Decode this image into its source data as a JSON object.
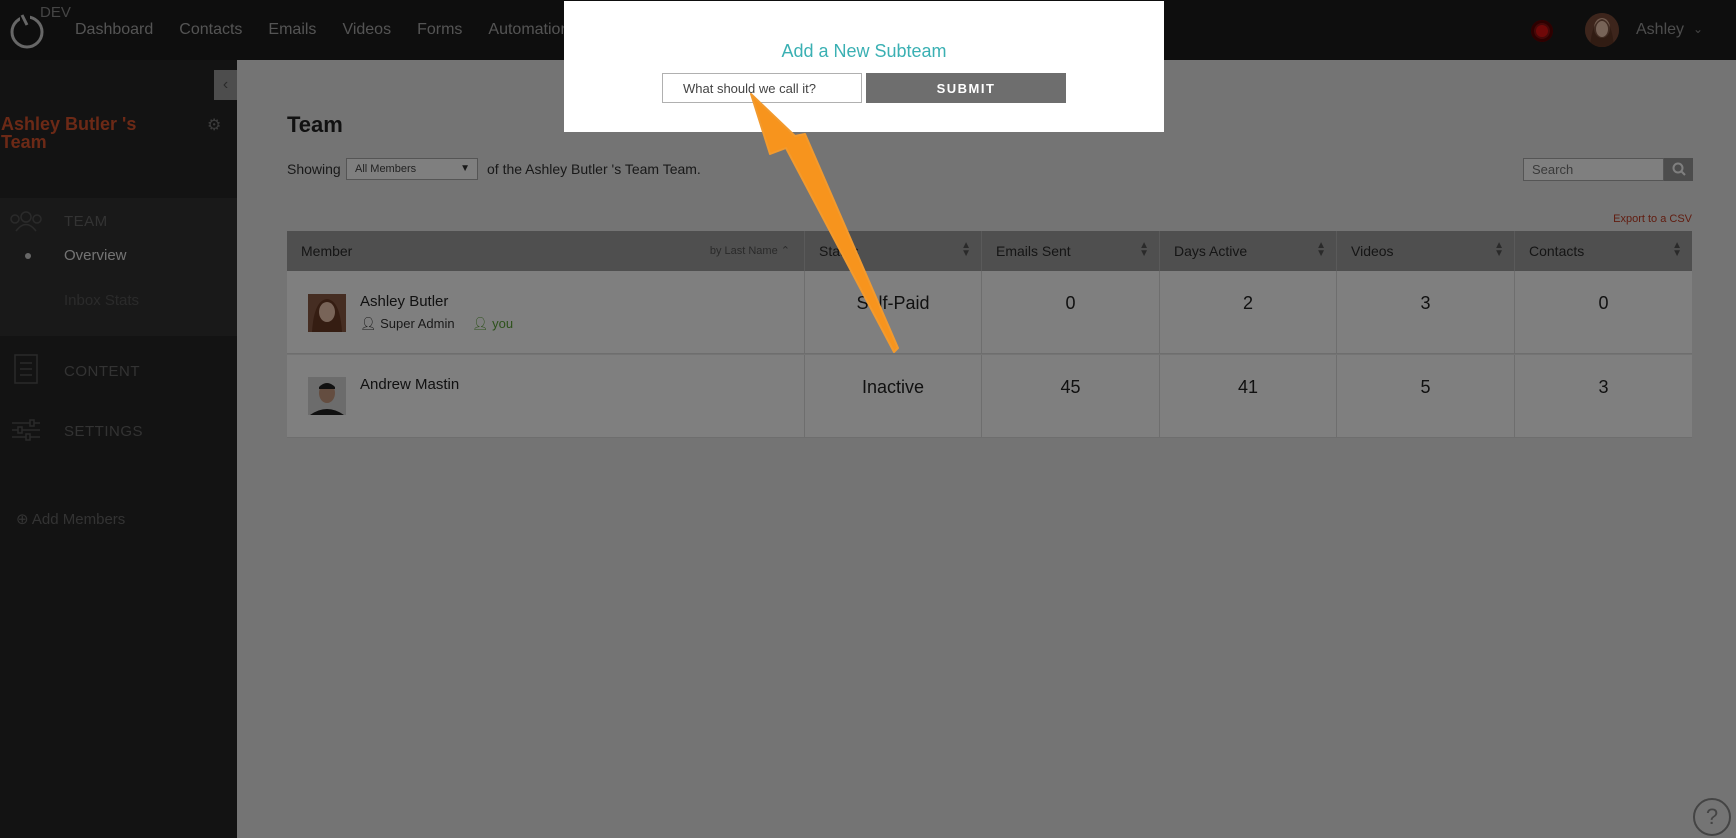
{
  "topbar": {
    "env_label": "DEV",
    "nav": [
      "Dashboard",
      "Contacts",
      "Emails",
      "Videos",
      "Forms",
      "Automations"
    ],
    "username": "Ashley"
  },
  "sidebar": {
    "team_name": "Ashley Butler 's Team",
    "sections": {
      "team": "TEAM",
      "content": "CONTENT",
      "settings": "SETTINGS"
    },
    "team_items": [
      "Overview",
      "Inbox Stats"
    ],
    "add_members": "Add Members"
  },
  "main": {
    "title": "Team",
    "showing_label": "Showing",
    "member_filter": "All Members",
    "showing_suffix": "of the Ashley Butler 's Team Team.",
    "search_placeholder": "Search",
    "export_label": "Export to a CSV"
  },
  "table": {
    "columns": [
      "Member",
      "Status",
      "Emails Sent",
      "Days Active",
      "Videos",
      "Contacts"
    ],
    "member_sort_label": "by Last Name",
    "rows": [
      {
        "name": "Ashley Butler",
        "role": "Super Admin",
        "you": "you",
        "status": "Self-Paid",
        "emails_sent": "0",
        "days_active": "2",
        "videos": "3",
        "contacts": "0"
      },
      {
        "name": "Andrew Mastin",
        "status": "Inactive",
        "emails_sent": "45",
        "days_active": "41",
        "videos": "5",
        "contacts": "3"
      }
    ]
  },
  "modal": {
    "title": "Add a New Subteam",
    "input_placeholder": "What should we call it?",
    "submit_label": "SUBMIT"
  },
  "help": {
    "label": "?"
  },
  "colors": {
    "accent_teal": "#3ab0b3",
    "brand_orange": "#d9532c",
    "annotation_arrow": "#f7941d"
  }
}
